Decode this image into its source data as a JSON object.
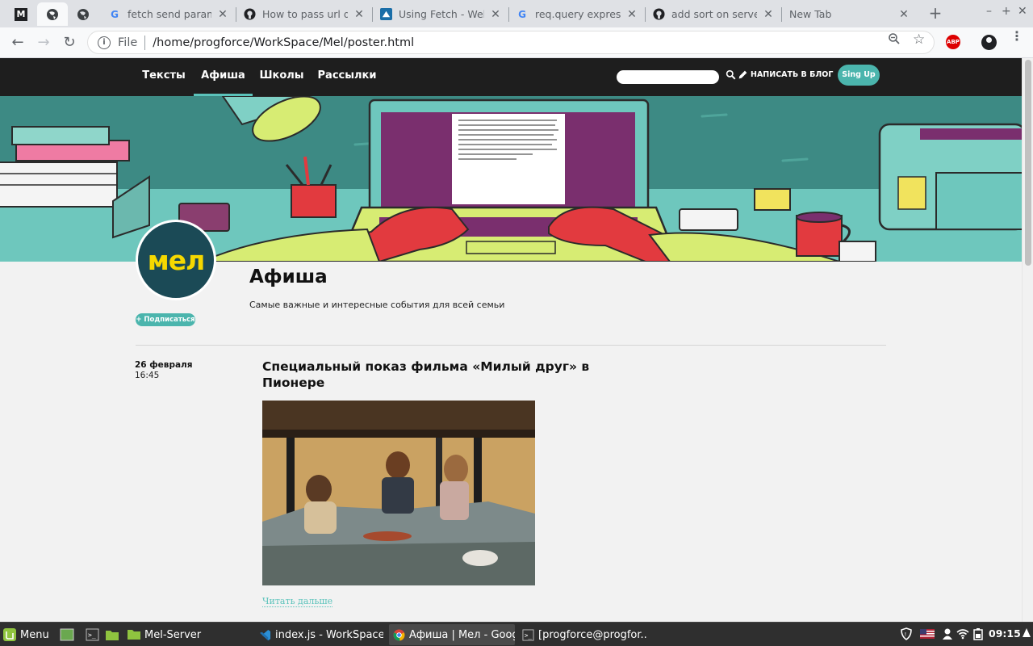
{
  "browser": {
    "tabs": [
      {
        "title": "fetch send params",
        "icon": "google-icon"
      },
      {
        "title": "How to pass url query",
        "icon": "github-icon"
      },
      {
        "title": "Using Fetch - Web APIs",
        "icon": "mdn-icon"
      },
      {
        "title": "req.query express",
        "icon": "google-icon"
      },
      {
        "title": "add sort on server",
        "icon": "github-icon"
      },
      {
        "title": "New Tab",
        "icon": ""
      }
    ],
    "address": {
      "scheme": "File",
      "path": "/home/progforce/WorkSpace/Mel/poster.html"
    },
    "abp_label": "ABP"
  },
  "site": {
    "nav": [
      "Тексты",
      "Афиша",
      "Школы",
      "Рассылки"
    ],
    "active_nav": "Афиша",
    "search_placeholder": "",
    "write_label": "НАПИСАТЬ В БЛОГ",
    "signup_label": "Sing Up",
    "logo_text": "мел",
    "subscribe_label": "+ Подписаться",
    "page_title": "Афиша",
    "page_description": "Самые важные и интересные события для всей семьи",
    "event": {
      "date": "26 февраля",
      "time": "16:45",
      "title": "Специальный показ фильма «Милый друг» в Пионере",
      "read_more": "Читать дальше"
    }
  },
  "taskbar": {
    "menu_label": "Menu",
    "windows": [
      {
        "title": "Mel-Server",
        "icon": "folder-icon"
      },
      {
        "title": "index.js - WorkSpace...",
        "icon": "vscode-icon"
      },
      {
        "title": "Афиша | Мел - Goog...",
        "icon": "chrome-icon"
      },
      {
        "title": "[progforce@progfor...",
        "icon": "terminal-icon"
      }
    ],
    "clock": "09:15"
  },
  "colors": {
    "accent": "#4bb5ad",
    "nav_bg": "#1e1e1e",
    "logo_bg": "#1b4a56",
    "logo_text": "#f5d800"
  }
}
